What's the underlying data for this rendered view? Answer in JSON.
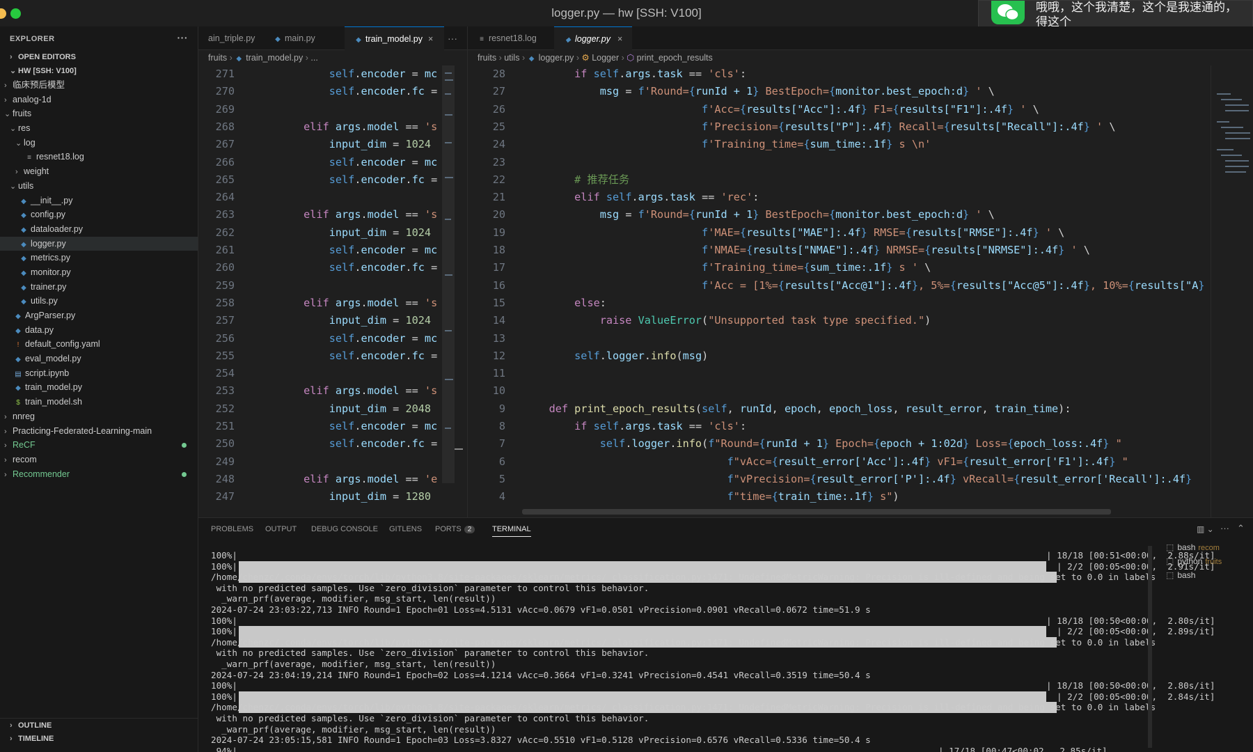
{
  "window": {
    "title": "logger.py — hw [SSH: V100]"
  },
  "notification": {
    "text": "哦哦，这个我清楚，这个是我速通的，得这个"
  },
  "sidebar": {
    "header": "EXPLORER",
    "more": "···",
    "open_editors": "OPEN EDITORS",
    "root": "HW [SSH: V100]",
    "items": [
      {
        "label": "临床预后模型",
        "depth": 1,
        "folder": true,
        "open": false
      },
      {
        "label": "analog-1d",
        "depth": 1,
        "folder": true,
        "open": false
      },
      {
        "label": "fruits",
        "depth": 1,
        "folder": true,
        "open": true
      },
      {
        "label": "res",
        "depth": 2,
        "folder": true,
        "open": true
      },
      {
        "label": "log",
        "depth": 3,
        "folder": true,
        "open": true
      },
      {
        "label": "resnet18.log",
        "depth": 4,
        "file": "log"
      },
      {
        "label": "weight",
        "depth": 3,
        "folder": true,
        "open": false
      },
      {
        "label": "utils",
        "depth": 2,
        "folder": true,
        "open": true
      },
      {
        "label": "__init__.py",
        "depth": 3,
        "file": "py"
      },
      {
        "label": "config.py",
        "depth": 3,
        "file": "py"
      },
      {
        "label": "dataloader.py",
        "depth": 3,
        "file": "py"
      },
      {
        "label": "logger.py",
        "depth": 3,
        "file": "py",
        "active": true
      },
      {
        "label": "metrics.py",
        "depth": 3,
        "file": "py"
      },
      {
        "label": "monitor.py",
        "depth": 3,
        "file": "py"
      },
      {
        "label": "trainer.py",
        "depth": 3,
        "file": "py"
      },
      {
        "label": "utils.py",
        "depth": 3,
        "file": "py"
      },
      {
        "label": "ArgParser.py",
        "depth": 2,
        "file": "py"
      },
      {
        "label": "data.py",
        "depth": 2,
        "file": "py"
      },
      {
        "label": "default_config.yaml",
        "depth": 2,
        "file": "yaml"
      },
      {
        "label": "eval_model.py",
        "depth": 2,
        "file": "py"
      },
      {
        "label": "script.ipynb",
        "depth": 2,
        "file": "nb"
      },
      {
        "label": "train_model.py",
        "depth": 2,
        "file": "py"
      },
      {
        "label": "train_model.sh",
        "depth": 2,
        "file": "sh"
      },
      {
        "label": "nnreg",
        "depth": 1,
        "folder": true,
        "open": false
      },
      {
        "label": "Practicing-Federated-Learning-main",
        "depth": 1,
        "folder": true,
        "open": false
      },
      {
        "label": "ReCF",
        "depth": 1,
        "folder": true,
        "open": false,
        "git": true
      },
      {
        "label": "recom",
        "depth": 1,
        "folder": true,
        "open": false
      },
      {
        "label": "Recommender",
        "depth": 1,
        "folder": true,
        "open": false,
        "git": true
      }
    ],
    "outline": "OUTLINE",
    "timeline": "TIMELINE"
  },
  "editor1": {
    "tabs": [
      "ain_triple.py",
      "main.py",
      "train_model.py"
    ],
    "more": "···",
    "breadcrumb": [
      "fruits",
      "train_model.py",
      "..."
    ],
    "lines": [
      {
        "n": "271",
        "t": "            self.encoder = mc"
      },
      {
        "n": "270",
        "t": "            self.encoder.fc ="
      },
      {
        "n": "269",
        "t": ""
      },
      {
        "n": "268",
        "t": "        elif args.model == 's"
      },
      {
        "n": "267",
        "t": "            input_dim = 1024"
      },
      {
        "n": "266",
        "t": "            self.encoder = mc"
      },
      {
        "n": "265",
        "t": "            self.encoder.fc ="
      },
      {
        "n": "264",
        "t": ""
      },
      {
        "n": "263",
        "t": "        elif args.model == 's"
      },
      {
        "n": "262",
        "t": "            input_dim = 1024"
      },
      {
        "n": "261",
        "t": "            self.encoder = mc"
      },
      {
        "n": "260",
        "t": "            self.encoder.fc ="
      },
      {
        "n": "259",
        "t": ""
      },
      {
        "n": "258",
        "t": "        elif args.model == 's"
      },
      {
        "n": "257",
        "t": "            input_dim = 1024"
      },
      {
        "n": "256",
        "t": "            self.encoder = mc"
      },
      {
        "n": "255",
        "t": "            self.encoder.fc ="
      },
      {
        "n": "254",
        "t": ""
      },
      {
        "n": "253",
        "t": "        elif args.model == 's"
      },
      {
        "n": "252",
        "t": "            input_dim = 2048"
      },
      {
        "n": "251",
        "t": "            self.encoder = mc"
      },
      {
        "n": "250",
        "t": "            self.encoder.fc ="
      },
      {
        "n": "249",
        "t": ""
      },
      {
        "n": "248",
        "t": "        elif args.model == 'e"
      },
      {
        "n": "247",
        "t": "            input_dim = 1280"
      }
    ]
  },
  "editor2": {
    "tabs": [
      "resnet18.log",
      "logger.py"
    ],
    "breadcrumb": [
      "fruits",
      "utils",
      "logger.py",
      "Logger",
      "print_epoch_results"
    ],
    "lines": [
      {
        "n": "28",
        "t": "        if self.args.task == 'cls':"
      },
      {
        "n": "27",
        "t": "            msg = f'Round={runId + 1} BestEpoch={monitor.best_epoch:d} ' \\"
      },
      {
        "n": "26",
        "t": "                            f'Acc={results[\"Acc\"]:.4f} F1={results[\"F1\"]:.4f} ' \\"
      },
      {
        "n": "25",
        "t": "                            f'Precision={results[\"P\"]:.4f} Recall={results[\"Recall\"]:.4f} ' \\"
      },
      {
        "n": "24",
        "t": "                            f'Training_time={sum_time:.1f} s \\n'"
      },
      {
        "n": "23",
        "t": ""
      },
      {
        "n": "22",
        "t": "        # 推荐任务"
      },
      {
        "n": "21",
        "t": "        elif self.args.task == 'rec':"
      },
      {
        "n": "20",
        "t": "            msg = f'Round={runId + 1} BestEpoch={monitor.best_epoch:d} ' \\"
      },
      {
        "n": "19",
        "t": "                            f'MAE={results[\"MAE\"]:.4f} RMSE={results[\"RMSE\"]:.4f} ' \\"
      },
      {
        "n": "18",
        "t": "                            f'NMAE={results[\"NMAE\"]:.4f} NRMSE={results[\"NRMSE\"]:.4f} ' \\"
      },
      {
        "n": "17",
        "t": "                            f'Training_time={sum_time:.1f} s ' \\"
      },
      {
        "n": "16",
        "t": "                            f'Acc = [1%={results[\"Acc@1\"]:.4f}, 5%={results[\"Acc@5\"]:.4f}, 10%={results[\"A"
      },
      {
        "n": "15",
        "t": "        else:"
      },
      {
        "n": "14",
        "t": "            raise ValueError(\"Unsupported task type specified.\")"
      },
      {
        "n": "13",
        "t": ""
      },
      {
        "n": "12",
        "t": "        self.logger.info(msg)"
      },
      {
        "n": "11",
        "t": ""
      },
      {
        "n": "10",
        "t": ""
      },
      {
        "n": "9",
        "t": "    def print_epoch_results(self, runId, epoch, epoch_loss, result_error, train_time):"
      },
      {
        "n": "8",
        "t": "        if self.args.task == 'cls':"
      },
      {
        "n": "7",
        "t": "            self.logger.info(f\"Round={runId + 1} Epoch={epoch + 1:02d} Loss={epoch_loss:.4f} \""
      },
      {
        "n": "6",
        "t": "                                f\"vAcc={result_error['Acc']:.4f} vF1={result_error['F1']:.4f} \""
      },
      {
        "n": "5",
        "t": "                                f\"vPrecision={result_error['P']:.4f} vRecall={result_error['Recall']:.4f}"
      },
      {
        "n": "4",
        "t": "                                f\"time={train_time:.1f} s\")"
      }
    ]
  },
  "panel": {
    "tabs": [
      "PROBLEMS",
      "OUTPUT",
      "DEBUG CONSOLE",
      "GITLENS",
      "PORTS",
      "TERMINAL"
    ],
    "ports_badge": "2",
    "terminal_lines": [
      {
        "t": "100%|",
        "bar": 1200,
        "tail": "| 18/18 [00:51<00:00,  2.88s/it]"
      },
      {
        "t": "100%|",
        "bar": 1215,
        "tail": "| 2/2 [00:05<00:00,  2.91s/it]"
      },
      {
        "t": "/home/chenzc/.conda/envs/torch/lib/python3.8/site-packages/sklearn/metrics/_classification.py:1471: UndefinedMetricWarning: Precision is ill-defined and being set to 0.0 in labels"
      },
      {
        "t": " with no predicted samples. Use `zero_division` parameter to control this behavior."
      },
      {
        "t": "  _warn_prf(average, modifier, msg_start, len(result))"
      },
      {
        "t": "2024-07-24 23:03:22,713 INFO Round=1 Epoch=01 Loss=4.5131 vAcc=0.0679 vF1=0.0501 vPrecision=0.0901 vRecall=0.0672 time=51.9 s"
      },
      {
        "t": "100%|",
        "bar": 1200,
        "tail": "| 18/18 [00:50<00:00,  2.80s/it]"
      },
      {
        "t": "100%|",
        "bar": 1215,
        "tail": "| 2/2 [00:05<00:00,  2.89s/it]"
      },
      {
        "t": "/home/chenzc/.conda/envs/torch/lib/python3.8/site-packages/sklearn/metrics/_classification.py:1471: UndefinedMetricWarning: Precision is ill-defined and being set to 0.0 in labels"
      },
      {
        "t": " with no predicted samples. Use `zero_division` parameter to control this behavior."
      },
      {
        "t": "  _warn_prf(average, modifier, msg_start, len(result))"
      },
      {
        "t": "2024-07-24 23:04:19,214 INFO Round=1 Epoch=02 Loss=4.1214 vAcc=0.3664 vF1=0.3241 vPrecision=0.4541 vRecall=0.3519 time=50.4 s"
      },
      {
        "t": "100%|",
        "bar": 1200,
        "tail": "| 18/18 [00:50<00:00,  2.80s/it]"
      },
      {
        "t": "100%|",
        "bar": 1215,
        "tail": "| 2/2 [00:05<00:00,  2.84s/it]"
      },
      {
        "t": "/home/chenzc/.conda/envs/torch/lib/python3.8/site-packages/sklearn/metrics/_classification.py:1471: UndefinedMetricWarning: Precision is ill-defined and being set to 0.0 in labels"
      },
      {
        "t": " with no predicted samples. Use `zero_division` parameter to control this behavior."
      },
      {
        "t": "  _warn_prf(average, modifier, msg_start, len(result))"
      },
      {
        "t": "2024-07-24 23:05:15,581 INFO Round=1 Epoch=03 Loss=3.8327 vAcc=0.5510 vF1=0.5128 vPrecision=0.6576 vRecall=0.5336 time=50.4 s"
      },
      {
        "t": " 94%|",
        "bar": 1045,
        "tail": "| 17/18 [00:47<00:02,  2.85s/it]"
      }
    ],
    "terminals": [
      {
        "name": "bash",
        "sub": "recom"
      },
      {
        "name": "python",
        "sub": "fruits"
      },
      {
        "name": "bash",
        "sub": ""
      }
    ]
  },
  "colors": {
    "accent": "#0078d4",
    "git": "#73c991"
  }
}
